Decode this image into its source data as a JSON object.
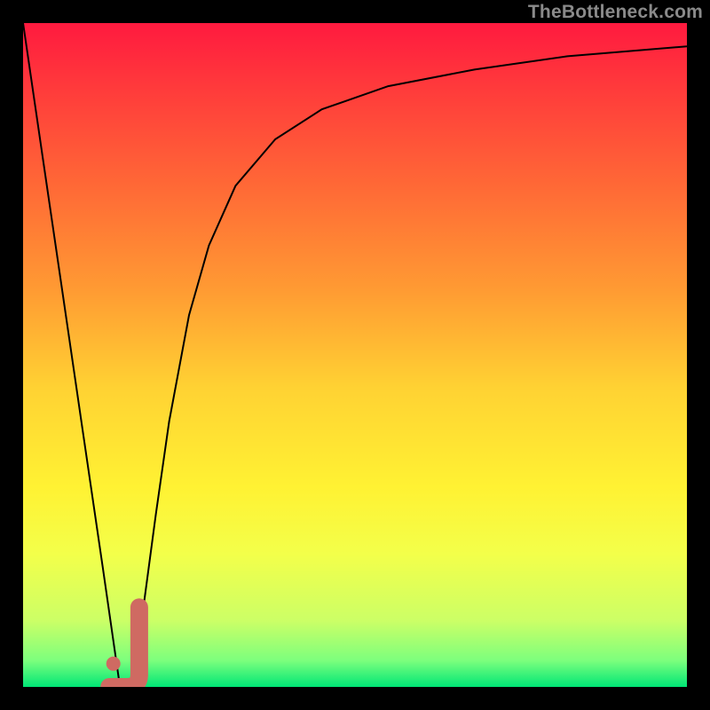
{
  "watermark": "TheBottleneck.com",
  "chart_data": {
    "type": "line",
    "title": "",
    "xlabel": "",
    "ylabel": "",
    "xlim": [
      0,
      100
    ],
    "ylim": [
      0,
      100
    ],
    "grid": false,
    "legend": false,
    "background_gradient": {
      "stops": [
        {
          "offset": 0.0,
          "color": "#ff1a3f"
        },
        {
          "offset": 0.1,
          "color": "#ff3b3b"
        },
        {
          "offset": 0.25,
          "color": "#ff6a36"
        },
        {
          "offset": 0.4,
          "color": "#ff9a33"
        },
        {
          "offset": 0.55,
          "color": "#ffd233"
        },
        {
          "offset": 0.7,
          "color": "#fff233"
        },
        {
          "offset": 0.8,
          "color": "#f3ff4a"
        },
        {
          "offset": 0.9,
          "color": "#ccff66"
        },
        {
          "offset": 0.96,
          "color": "#7dff7d"
        },
        {
          "offset": 1.0,
          "color": "#00e676"
        }
      ]
    },
    "series": [
      {
        "name": "bottleneck-curve",
        "stroke": "#000000",
        "stroke_width": 2,
        "x": [
          0.0,
          3.0,
          6.0,
          9.0,
          12.0,
          14.6,
          16.0,
          17.0,
          18.0,
          19.0,
          20.0,
          22.0,
          25.0,
          28.0,
          32.0,
          38.0,
          45.0,
          55.0,
          68.0,
          82.0,
          100.0
        ],
        "values": [
          100.0,
          79.5,
          59.0,
          38.5,
          18.0,
          0.0,
          0.0,
          4.0,
          11.0,
          18.5,
          26.0,
          40.0,
          56.0,
          66.5,
          75.5,
          82.5,
          87.0,
          90.5,
          93.0,
          95.0,
          96.5
        ]
      }
    ],
    "markers": [
      {
        "name": "indicator-j",
        "shape": "J",
        "stroke": "#cf6a62",
        "stroke_width": 20,
        "x_range": [
          13.0,
          17.5
        ],
        "y_range": [
          0.0,
          12.0
        ],
        "dot": {
          "x": 13.6,
          "y": 3.5,
          "r": 8
        }
      }
    ]
  }
}
